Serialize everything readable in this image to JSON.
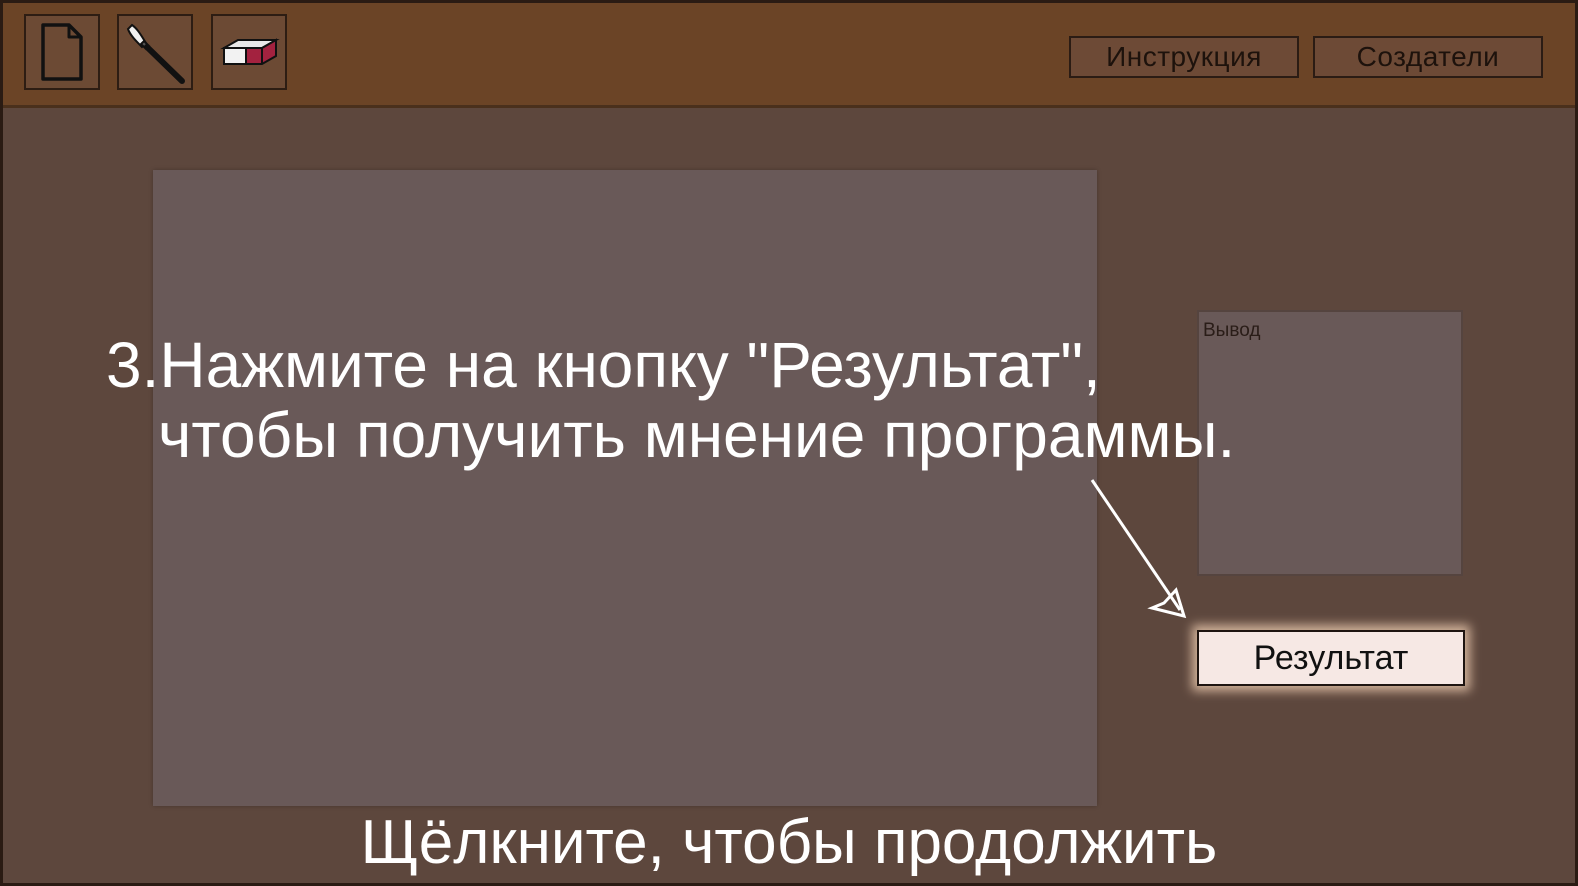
{
  "toolbar": {
    "tools": [
      {
        "name": "new-file",
        "icon": "new-file-icon"
      },
      {
        "name": "brush",
        "icon": "brush-icon"
      },
      {
        "name": "eraser",
        "icon": "eraser-icon"
      }
    ],
    "instructions_label": "Инструкция",
    "creators_label": "Создатели"
  },
  "output": {
    "label": "Вывод"
  },
  "result_button": {
    "label": "Результат"
  },
  "tutorial": {
    "line1": "3.Нажмите на кнопку \"Результат\",",
    "line2": "чтобы получить мнение программы.",
    "continue_hint": "Щёлкните, чтобы продолжить"
  },
  "colors": {
    "toolbar": "#6b4426",
    "workspace": "#5d473d",
    "canvas": "#695958",
    "result_button_bg": "#f6e8e4",
    "tutorial_text": "#ffffff"
  }
}
